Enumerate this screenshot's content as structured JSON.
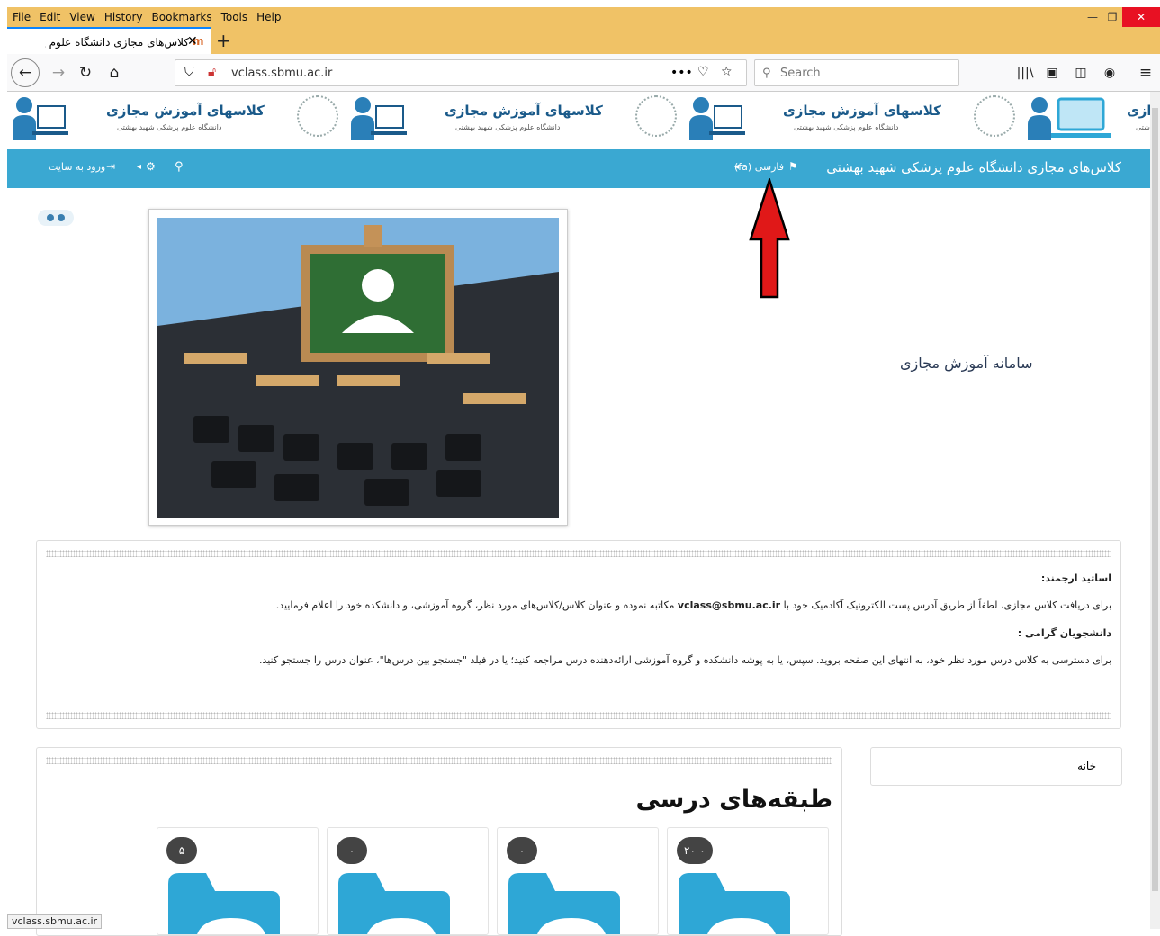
{
  "menu": [
    "File",
    "Edit",
    "View",
    "History",
    "Bookmarks",
    "Tools",
    "Help"
  ],
  "tab": {
    "title": "کلاس‌های مجازی دانشگاه علوم پزشکی",
    "favicon": "m"
  },
  "toolbar": {
    "url": "vclass.sbmu.ac.ir",
    "search_placeholder": "Search",
    "more": "•••"
  },
  "banner": {
    "title": "کلاسهای آموزش مجازی",
    "subtitle": "دانشگاه علوم پزشکی شهید بهشتی",
    "partial_title": "ازی",
    "partial_subtitle": "شتی"
  },
  "nav": {
    "site_name": "کلاس‌های مجازی دانشگاه علوم پزشکی شهید بهشتی",
    "language": "فارسی ‎(fa)",
    "login": "ورود به سایت"
  },
  "slideshow": {
    "title": "سامانه آموزش مجازی"
  },
  "notice": {
    "line1": "اساتید ارجمند:",
    "line2_a": "برای دریافت کلاس مجازی، لطفاً از طریق آدرس پست الکترونیک آکادمیک خود با",
    "email": "vclass@sbmu.ac.ir",
    "line2_b": "مکاتبه نموده و عنوان کلاس/کلاس‌های مورد نظر، گروه آموزشی، و دانشکده خود را اعلام فرمایید.",
    "line3": "دانشجویان گرامی :",
    "line4": "برای دسترسی به کلاس درس مورد نظر خود، به انتهای این صفحه بروید. سپس، یا به پوشه دانشکده و گروه آموزشی ارائه‌دهنده درس مراجعه کنید؛ یا در فیلد \"جستجو بین درس‌ها\"، عنوان درس را جستجو کنید."
  },
  "categories": {
    "title": "طبقه‌های درسی",
    "cards": [
      {
        "count": "۲۰-۰"
      },
      {
        "count": "۰"
      },
      {
        "count": "۰"
      },
      {
        "count": "۵"
      }
    ]
  },
  "home_block": {
    "label": "خانه"
  },
  "status": {
    "link": "vclass.sbmu.ac.ir"
  },
  "colors": {
    "nav_strip": "#3aa8d2",
    "titlebar": "#f0c266",
    "folder": "#2ea7d6",
    "arrow": "#e01818"
  }
}
